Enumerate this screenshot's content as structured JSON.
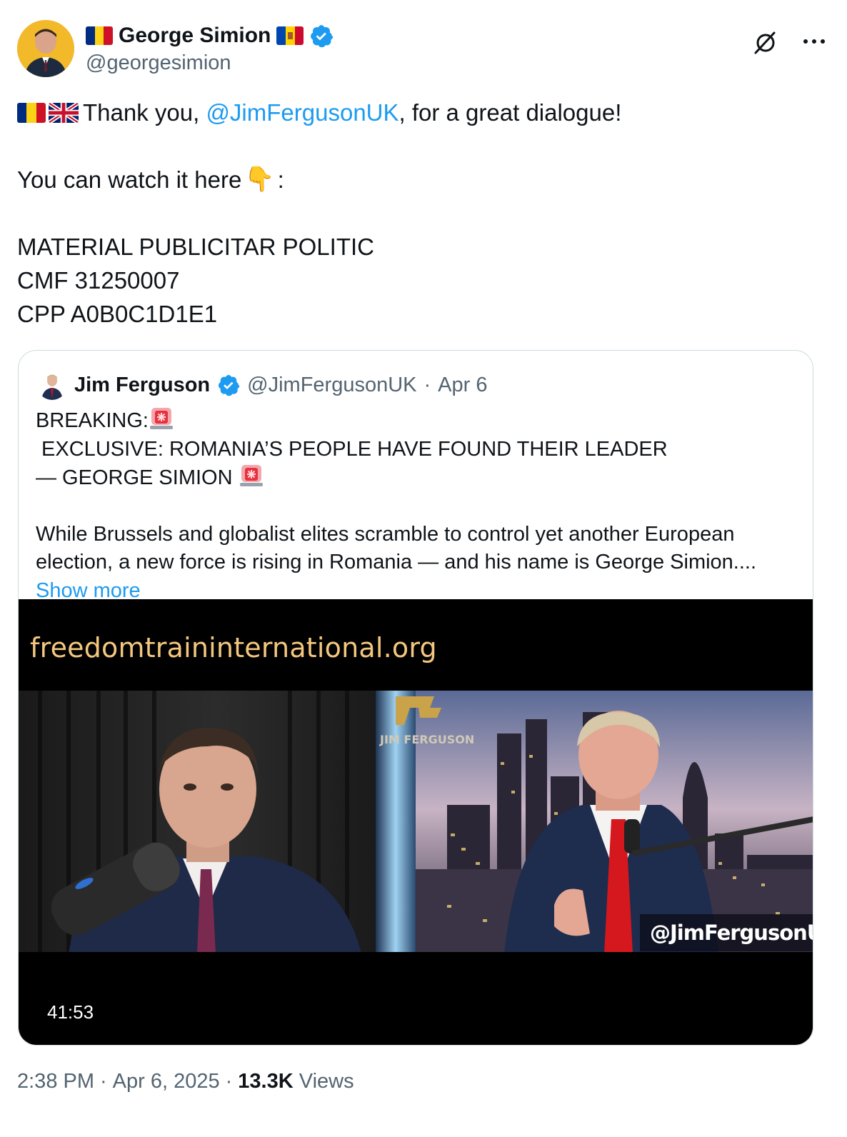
{
  "author": {
    "name": "George Simion",
    "handle": "@georgesimion",
    "verified": true,
    "flag_left": "romania-flag",
    "flag_right": "moldova-flag"
  },
  "actions": {
    "grok_icon": "grok-icon",
    "more_icon": "more-options-icon"
  },
  "tweet": {
    "flags": [
      "romania-flag",
      "uk-flag"
    ],
    "line1_prefix": "Thank you, ",
    "line1_mention": "@JimFergusonUK",
    "line1_suffix": ", for a great dialogue!",
    "line2_text": "You can watch it here",
    "line2_emoji": "👇",
    "line2_suffix": ":",
    "line3": "MATERIAL PUBLICITAR POLITIC",
    "line4": "CMF 31250007",
    "line5": "CPP A0B0C1D1E1"
  },
  "quote": {
    "name": "Jim Ferguson",
    "handle": "@JimFergusonUK",
    "separator": "·",
    "date": "Apr 6",
    "headline_1a": "BREAKING:",
    "headline_1b": " EXCLUSIVE: ROMANIA’S PEOPLE HAVE FOUND THEIR LEADER",
    "headline_2": "— GEORGE SIMION ",
    "body_1": "While Brussels and globalist elites scramble to control yet another European",
    "body_2": "election, a new force is rising in Romania — and his name is George Simion....",
    "show_more": "Show more"
  },
  "media": {
    "site_url": "freedomtraininternational.org",
    "overlay_handle": "@JimFergusonUK",
    "logo_text": "JIM FERGUSON",
    "duration": "41:53"
  },
  "footer": {
    "time": "2:38 PM",
    "dot1": "·",
    "date": "Apr 6, 2025",
    "dot2": "·",
    "views_count": "13.3K",
    "views_label": "Views"
  },
  "colors": {
    "accent": "#1d9bf0",
    "text": "#0f1419",
    "muted": "#536471",
    "border": "#cfd9de",
    "url_text": "#f4c77f"
  }
}
